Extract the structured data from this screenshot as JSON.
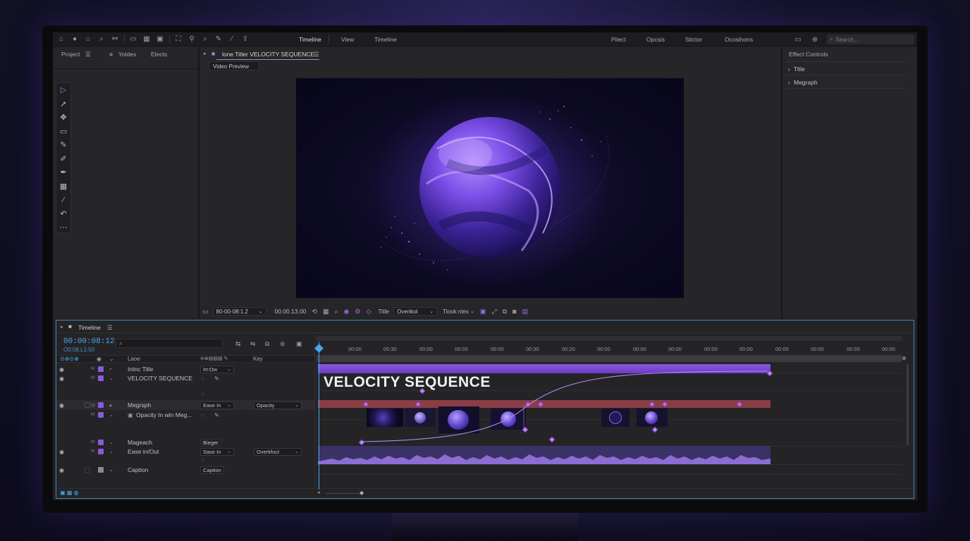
{
  "topbar": {
    "menus": [
      "Timeline",
      "View",
      "Timeline"
    ],
    "right_menus": [
      "Pilect",
      "Opcsis",
      "Stictor",
      "Ocosihons"
    ],
    "search_placeholder": "Search..."
  },
  "project_panel": {
    "tabs": [
      "Project",
      "Yoldes",
      "Elects"
    ]
  },
  "preview_panel": {
    "tab_label": "lone Titler VELOCITY SEQUENCE",
    "subtab": "Video Preview"
  },
  "effect_controls": {
    "title": "Effect Controls",
    "items": [
      "Title",
      "Megraph"
    ]
  },
  "preview_controls": {
    "timecode": "80-00-08:1.2",
    "duration": "00.00.13.00",
    "title_label": "Title",
    "overlay_select": "Overikol",
    "text_select": "Tlook ntex"
  },
  "timeline": {
    "title": "Timeline",
    "timecode": "00:00:08:12",
    "subtimecode": "O0:08.L1:50",
    "search_placeholder": "",
    "col_layer": "Laoe",
    "col_key": "Key",
    "layers": [
      {
        "name": "Intnc Title",
        "mode": "Irt:Ow"
      },
      {
        "name": "VELOCITY SEQUENCE",
        "mode": ""
      },
      {
        "name": "Megrsph",
        "mode": "Ease In",
        "prop": "Opacity"
      },
      {
        "name": "Opacity In win Meg...",
        "mode": ""
      },
      {
        "name": "Mageach",
        "mode": "Bieger"
      },
      {
        "name": "Ease in/Out",
        "mode": "Sase In",
        "prop": "Overkfoct"
      },
      {
        "name": "Caption",
        "mode": "Caption"
      }
    ],
    "ticks": [
      "00:00",
      "00:30",
      "00:00",
      "00:00",
      "00:00",
      "00:30",
      "00:20",
      "00:00",
      "00:00",
      "00:00",
      "00:00",
      "00:00",
      "00:00",
      "00:00",
      "00:00",
      "00:00"
    ],
    "clip_title": "VELOCITY SEQUENCE"
  },
  "colors": {
    "accent": "#8b5ad8",
    "timeline_border": "#3f86b8",
    "playhead": "#4aa6e8"
  }
}
